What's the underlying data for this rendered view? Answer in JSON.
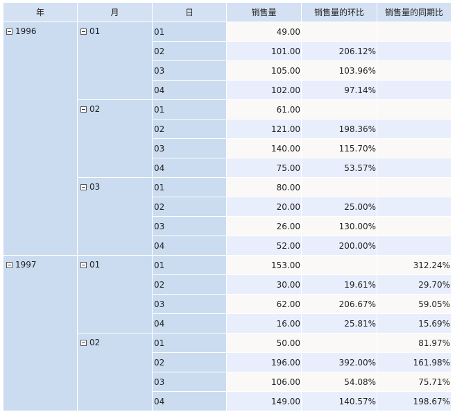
{
  "columns": [
    "年",
    "月",
    "日",
    "销售量",
    "销售量的环比",
    "销售量的同期比"
  ],
  "years": [
    {
      "label": "1996",
      "months": [
        {
          "label": "01",
          "rows": [
            {
              "day": "01",
              "sales": "49.00",
              "mom": "",
              "yoy": ""
            },
            {
              "day": "02",
              "sales": "101.00",
              "mom": "206.12%",
              "yoy": ""
            },
            {
              "day": "03",
              "sales": "105.00",
              "mom": "103.96%",
              "yoy": ""
            },
            {
              "day": "04",
              "sales": "102.00",
              "mom": "97.14%",
              "yoy": ""
            }
          ]
        },
        {
          "label": "02",
          "rows": [
            {
              "day": "01",
              "sales": "61.00",
              "mom": "",
              "yoy": ""
            },
            {
              "day": "02",
              "sales": "121.00",
              "mom": "198.36%",
              "yoy": ""
            },
            {
              "day": "03",
              "sales": "140.00",
              "mom": "115.70%",
              "yoy": ""
            },
            {
              "day": "04",
              "sales": "75.00",
              "mom": "53.57%",
              "yoy": ""
            }
          ]
        },
        {
          "label": "03",
          "rows": [
            {
              "day": "01",
              "sales": "80.00",
              "mom": "",
              "yoy": ""
            },
            {
              "day": "02",
              "sales": "20.00",
              "mom": "25.00%",
              "yoy": ""
            },
            {
              "day": "03",
              "sales": "26.00",
              "mom": "130.00%",
              "yoy": ""
            },
            {
              "day": "04",
              "sales": "52.00",
              "mom": "200.00%",
              "yoy": ""
            }
          ]
        }
      ]
    },
    {
      "label": "1997",
      "months": [
        {
          "label": "01",
          "rows": [
            {
              "day": "01",
              "sales": "153.00",
              "mom": "",
              "yoy": "312.24%"
            },
            {
              "day": "02",
              "sales": "30.00",
              "mom": "19.61%",
              "yoy": "29.70%"
            },
            {
              "day": "03",
              "sales": "62.00",
              "mom": "206.67%",
              "yoy": "59.05%"
            },
            {
              "day": "04",
              "sales": "16.00",
              "mom": "25.81%",
              "yoy": "15.69%"
            }
          ]
        },
        {
          "label": "02",
          "rows": [
            {
              "day": "01",
              "sales": "50.00",
              "mom": "",
              "yoy": "81.97%"
            },
            {
              "day": "02",
              "sales": "196.00",
              "mom": "392.00%",
              "yoy": "161.98%"
            },
            {
              "day": "03",
              "sales": "106.00",
              "mom": "54.08%",
              "yoy": "75.71%"
            },
            {
              "day": "04",
              "sales": "149.00",
              "mom": "140.57%",
              "yoy": "198.67%"
            }
          ]
        }
      ]
    }
  ]
}
